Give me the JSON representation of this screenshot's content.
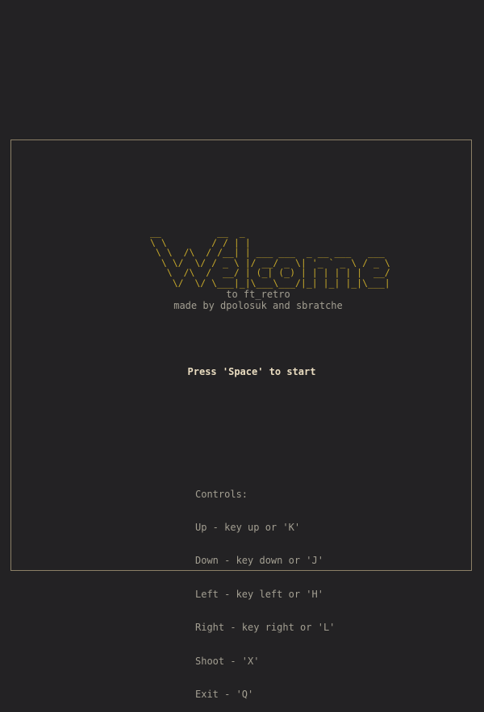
{
  "banner": {
    "ascii_art": "__          __  _                           \n\\ \\        / / | |                          \n \\ \\  /\\  / /__| | ___ ___  _ __ ___   ___ \n  \\ \\/  \\/ / _ \\ |/ __/ _ \\| '_ ` _ \\ / _ \\\n   \\  /\\  /  __/ | (_| (_) | | | | | |  __/\n    \\/  \\/ \\___|_|\\___\\___/|_| |_| |_|\\___|",
    "word": "Welcome"
  },
  "subtitle": {
    "line1": "to ft_retro",
    "line2": "made by dpolosuk and sbratche"
  },
  "prompt": "Press 'Space' to start",
  "controls": {
    "heading": "Controls:",
    "items": [
      "Up - key up or 'K'",
      "Down - key down or 'J'",
      "Left - key left or 'H'",
      "Right - key right or 'L'",
      "Shoot - 'X'",
      "Exit - 'Q'"
    ]
  },
  "colors": {
    "background": "#232224",
    "frame": "#8b8067",
    "banner": "#c4a62a",
    "text": "#a39f92",
    "highlight": "#e9dcc0"
  }
}
